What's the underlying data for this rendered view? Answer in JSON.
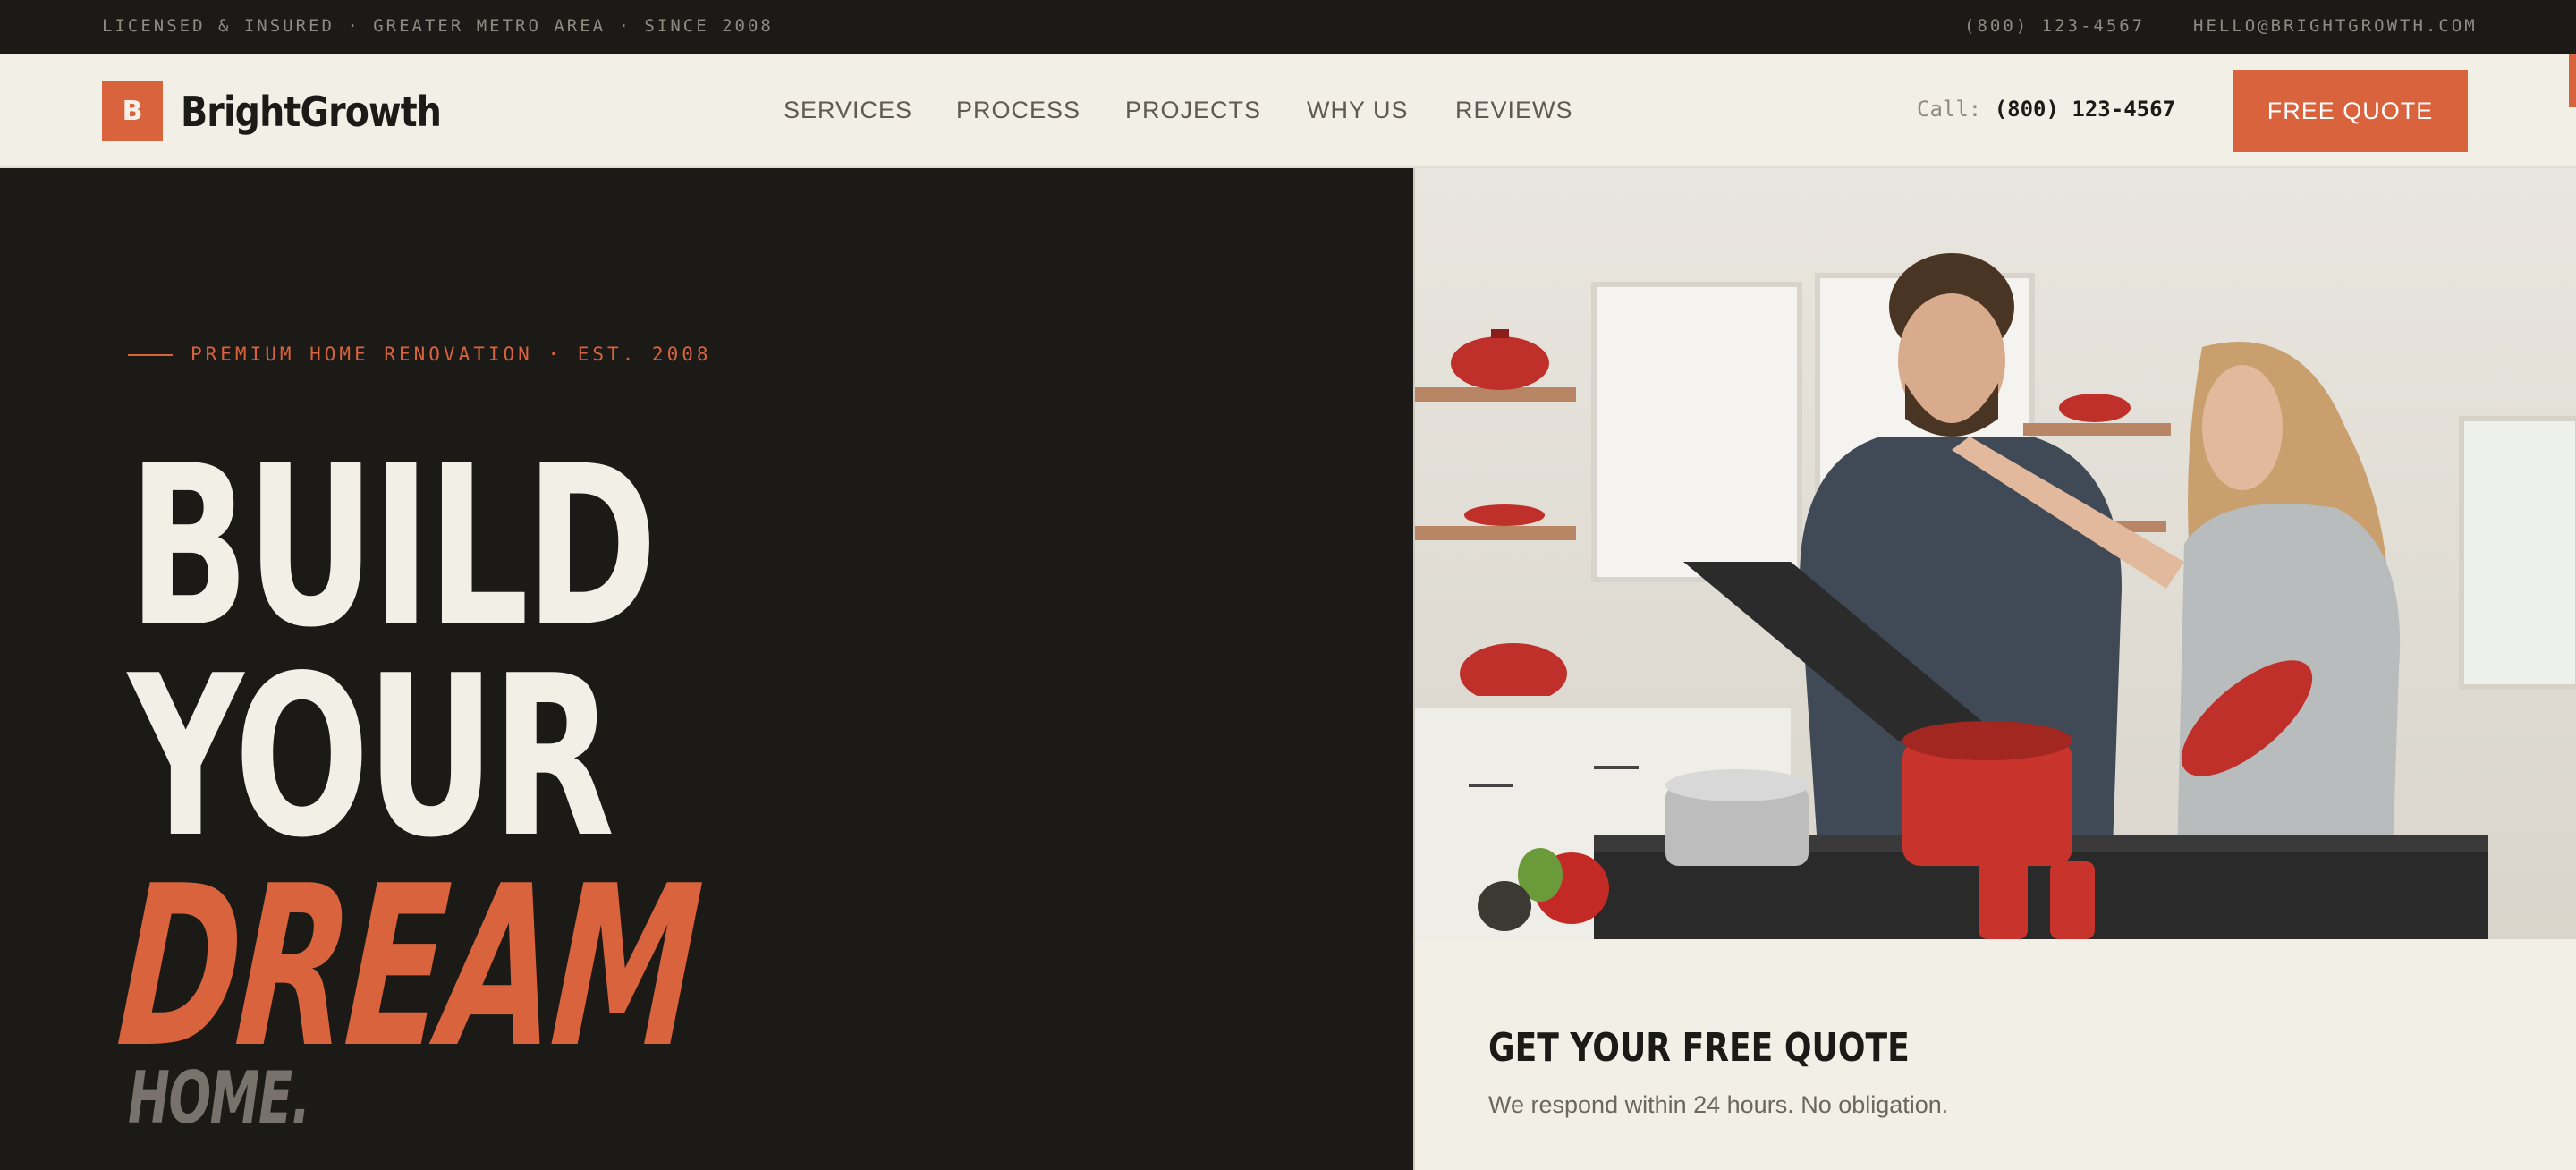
{
  "topbar": {
    "tagline": "LICENSED & INSURED · GREATER METRO AREA · SINCE 2008",
    "phone": "(800) 123-4567",
    "email": "HELLO@BRIGHTGROWTH.COM"
  },
  "header": {
    "logo_letter": "B",
    "brand": "BrightGrowth",
    "nav": [
      "SERVICES",
      "PROCESS",
      "PROJECTS",
      "WHY US",
      "REVIEWS"
    ],
    "call_label": "Call:",
    "call_number": "(800) 123-4567",
    "cta_label": "FREE QUOTE"
  },
  "hero": {
    "eyebrow": "PREMIUM HOME RENOVATION · EST. 2008",
    "headline": {
      "line1": "BUILD",
      "line2": "YOUR",
      "line3": "DREAM",
      "line4": "HOME."
    }
  },
  "quote_panel": {
    "title": "GET YOUR FREE QUOTE",
    "subtitle": "We respond within 24 hours. No obligation."
  },
  "colors": {
    "accent": "#d9633d",
    "dark": "#1c1a17",
    "cream": "#f2efe7"
  }
}
